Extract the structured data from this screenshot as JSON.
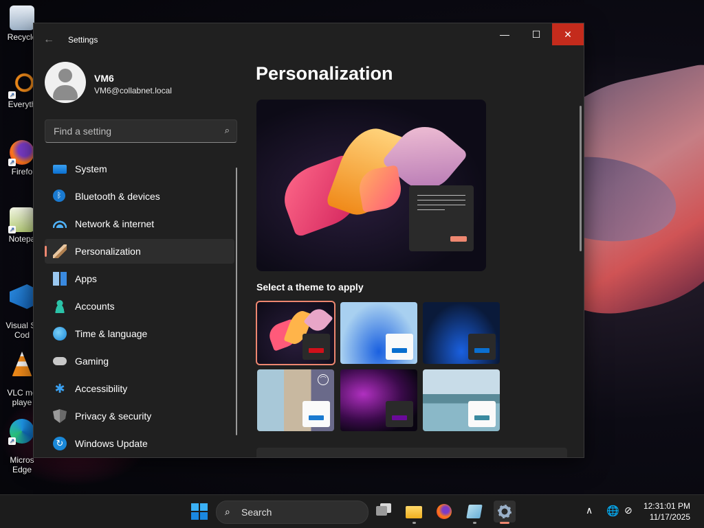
{
  "desktop": {
    "icons": [
      {
        "label": "Recycle"
      },
      {
        "label": "Everyth"
      },
      {
        "label": "Firefo"
      },
      {
        "label": "Notepa"
      },
      {
        "label": "Visual St\nCod"
      },
      {
        "label": "VLC me\nplaye"
      },
      {
        "label": "Micros\nEdge"
      }
    ]
  },
  "window": {
    "title": "Settings",
    "back_icon": "←",
    "minimize_icon": "—",
    "maximize_icon": "☐",
    "close_icon": "✕"
  },
  "profile": {
    "name": "VM6",
    "email": "VM6@collabnet.local"
  },
  "search": {
    "placeholder": "Find a setting",
    "icon": "⌕"
  },
  "nav": {
    "items": [
      {
        "label": "System",
        "icon": "system-icon"
      },
      {
        "label": "Bluetooth & devices",
        "icon": "bluetooth-icon"
      },
      {
        "label": "Network & internet",
        "icon": "wifi-icon"
      },
      {
        "label": "Personalization",
        "icon": "brush-icon",
        "active": true
      },
      {
        "label": "Apps",
        "icon": "apps-icon"
      },
      {
        "label": "Accounts",
        "icon": "person-icon"
      },
      {
        "label": "Time & language",
        "icon": "globe-icon"
      },
      {
        "label": "Gaming",
        "icon": "gamepad-icon"
      },
      {
        "label": "Accessibility",
        "icon": "accessibility-icon"
      },
      {
        "label": "Privacy & security",
        "icon": "shield-icon"
      },
      {
        "label": "Windows Update",
        "icon": "update-icon"
      }
    ]
  },
  "main": {
    "title": "Personalization",
    "theme_section_label": "Select a theme to apply",
    "themes": [
      {
        "name": "bloom-dark",
        "bar_color": "#d0101a",
        "selected": true
      },
      {
        "name": "windows-light",
        "bar_color": "#0a6fd0"
      },
      {
        "name": "windows-dark",
        "bar_color": "#0a6fd0"
      },
      {
        "name": "captured-motion",
        "bar_color": "#1a7ad0"
      },
      {
        "name": "glow",
        "bar_color": "#6a0a9a"
      },
      {
        "name": "flow",
        "bar_color": "#3a8aa0"
      }
    ],
    "accent_color": "#ee8770"
  },
  "taskbar": {
    "search_label": "Search",
    "search_icon": "⌕",
    "time": "12:31:01 PM",
    "date": "11/17/2025",
    "tray_chevron": "∧",
    "tray_globe": "🌐",
    "tray_network": "⊘"
  }
}
